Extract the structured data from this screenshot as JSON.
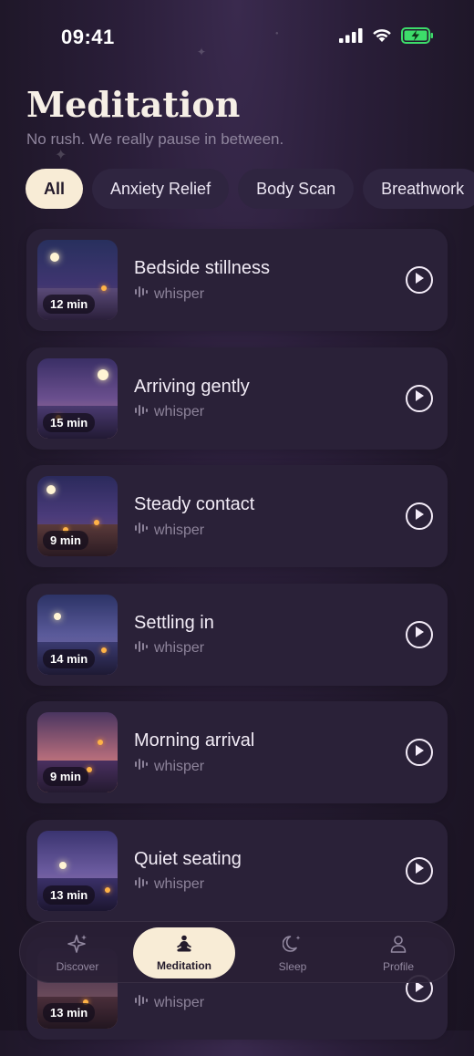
{
  "status_bar": {
    "time": "09:41",
    "icons": [
      "signal-icon",
      "wifi-icon",
      "battery-charging-icon"
    ]
  },
  "header": {
    "title": "Meditation",
    "subtitle": "No rush. We really pause in between."
  },
  "chips": [
    {
      "label": "All",
      "active": true
    },
    {
      "label": "Anxiety Relief",
      "active": false
    },
    {
      "label": "Body Scan",
      "active": false
    },
    {
      "label": "Breathwork",
      "active": false
    }
  ],
  "sessions": [
    {
      "title": "Bedside stillness",
      "meta": "whisper",
      "duration": "12 min"
    },
    {
      "title": "Arriving gently",
      "meta": "whisper",
      "duration": "15 min"
    },
    {
      "title": "Steady contact",
      "meta": "whisper",
      "duration": "9 min"
    },
    {
      "title": "Settling in",
      "meta": "whisper",
      "duration": "14 min"
    },
    {
      "title": "Morning arrival",
      "meta": "whisper",
      "duration": "9 min"
    },
    {
      "title": "Quiet seating",
      "meta": "whisper",
      "duration": "13 min"
    },
    {
      "title": "",
      "meta": "whisper",
      "duration": "13 min"
    }
  ],
  "nav": {
    "items": [
      {
        "label": "Discover",
        "icon": "sparkle-icon",
        "active": false
      },
      {
        "label": "Meditation",
        "icon": "meditation-icon",
        "active": true
      },
      {
        "label": "Sleep",
        "icon": "moon-icon",
        "active": false
      },
      {
        "label": "Profile",
        "icon": "person-icon",
        "active": false
      }
    ]
  },
  "colors": {
    "accent": "#f8ecd6",
    "background": "#221a2c",
    "card": "#2a2138"
  }
}
